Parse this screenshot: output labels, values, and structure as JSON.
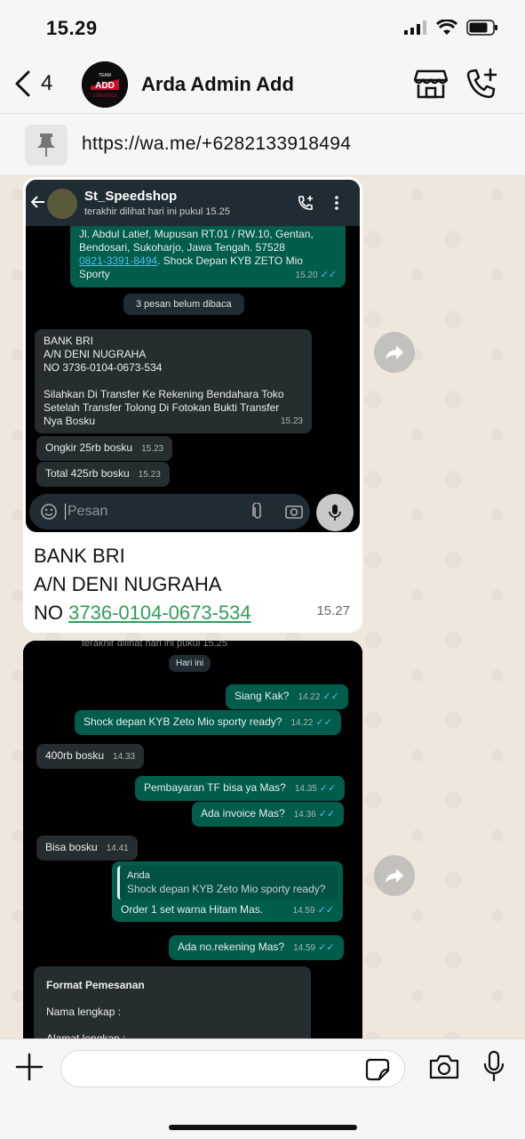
{
  "status_bar": {
    "time": "15.29"
  },
  "header": {
    "back_count": "4",
    "contact_name": "Arda Admin Add",
    "avatar_text": "TEAM ADD LOGISTICS"
  },
  "pinned": {
    "text": "https://wa.me/+6282133918494"
  },
  "image1": {
    "wa_name": "St_Speedshop",
    "wa_sub": "terakhir dilihat hari ini pukul 15.25",
    "addr_lines": [
      "Jl. Abdul Latief, Mupusan RT.01 / RW.10, Gentan,",
      "Bendosari, Sukoharjo, Jawa Tengah. 57528"
    ],
    "addr_link": "0821-3391-8494",
    "addr_tail": ". Shock Depan KYB ZETO Mio",
    "addr_tail2": "Sporty",
    "addr_time": "15.20",
    "unread": "3 pesan belum dibaca",
    "bank_lines": [
      "BANK BRI",
      "A/N DENI NUGRAHA",
      "NO 3736-0104-0673-534",
      "",
      "Silahkan Di Transfer Ke Rekening Bendahara Toko",
      "Setelah Transfer Tolong Di Fotokan Bukti Transfer",
      "Nya Bosku"
    ],
    "bank_time": "15.23",
    "ongkir": "Ongkir 25rb bosku",
    "ongkir_time": "15.23",
    "total": "Total 425rb bosku",
    "total_time": "15.23",
    "input_placeholder": "Pesan"
  },
  "caption1": {
    "line1": "BANK BRI",
    "line2": "A/N DENI NUGRAHA",
    "line3_prefix": "NO ",
    "line3_number": "3736-0104-0673-534",
    "time": "15.27"
  },
  "image2": {
    "sub_top": "terakhir dilihat hari ini pukul 15.25",
    "day": "Hari ini",
    "m1": "Siang Kak?",
    "m1_time": "14.22",
    "m2": "Shock depan KYB Zeto Mio sporty ready?",
    "m2_time": "14.22",
    "m3": "400rb bosku",
    "m3_time": "14.33",
    "m4": "Pembayaran TF bisa ya Mas?",
    "m4_time": "14.35",
    "m5": "Ada invoice Mas?",
    "m5_time": "14.36",
    "m6": "Bisa bosku",
    "m6_time": "14.41",
    "quote_author": "Anda",
    "quote_text": "Shock depan KYB Zeto Mio sporty ready?",
    "m7": "Order 1 set warna Hitam Mas.",
    "m7_time": "14.59",
    "m8": "Ada no.rekening Mas?",
    "m8_time": "14.59",
    "format_title": "Format Pemesanan",
    "format_name": "Nama lengkap :",
    "format_addr": "Alamat lengkap :"
  }
}
